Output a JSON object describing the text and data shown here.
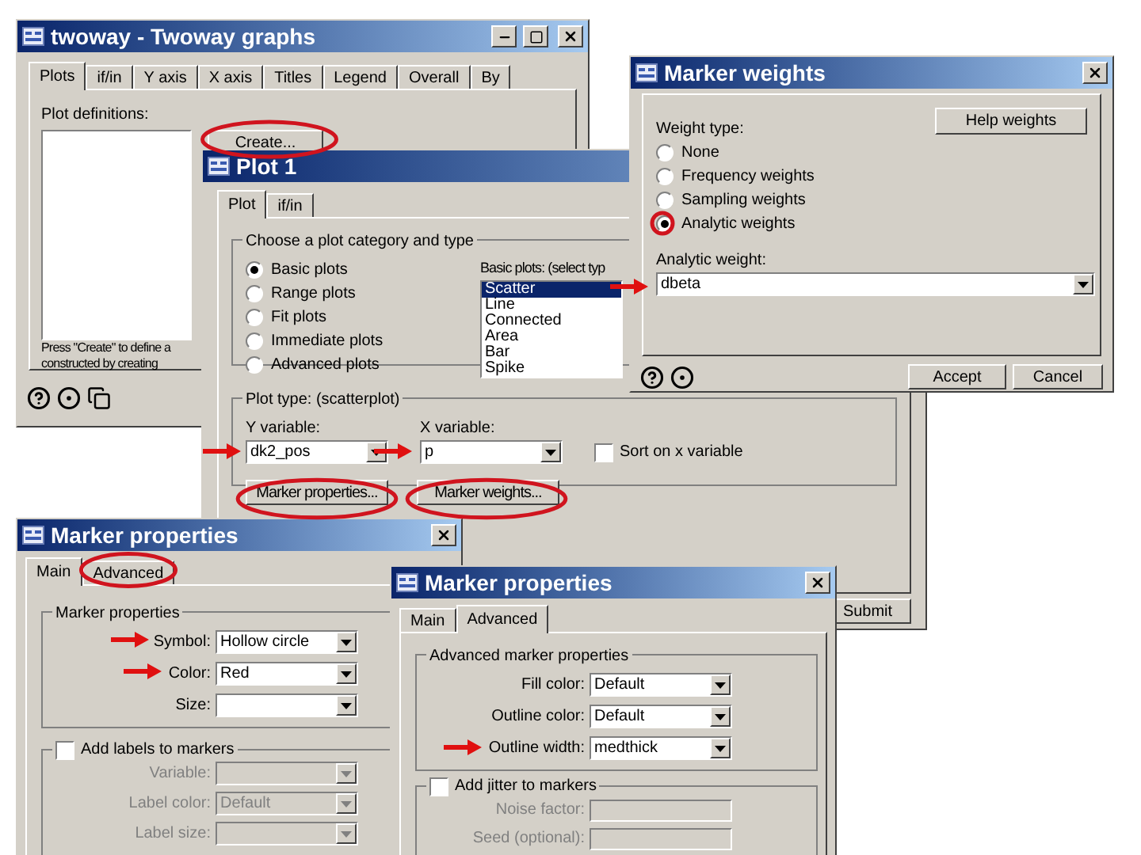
{
  "twoway_window": {
    "title": "twoway - Twoway graphs",
    "tabs": [
      {
        "label": "Plots",
        "selected": true
      },
      {
        "label": "if/in",
        "selected": false
      },
      {
        "label": "Y axis",
        "selected": false
      },
      {
        "label": "X axis",
        "selected": false
      },
      {
        "label": "Titles",
        "selected": false
      },
      {
        "label": "Legend",
        "selected": false
      },
      {
        "label": "Overall",
        "selected": false
      },
      {
        "label": "By",
        "selected": false
      }
    ],
    "list_label": "Plot definitions:",
    "create_button": "Create...",
    "hint_lines": [
      "Press \"Create\" to define a",
      "constructed by creating"
    ]
  },
  "plot1_window": {
    "title": "Plot 1",
    "tabs": [
      {
        "label": "Plot",
        "selected": true
      },
      {
        "label": "if/in",
        "selected": false
      }
    ],
    "category_group": {
      "title": "Choose a plot category and type",
      "options": [
        {
          "label": "Basic plots",
          "selected": true
        },
        {
          "label": "Range plots",
          "selected": false
        },
        {
          "label": "Fit plots",
          "selected": false
        },
        {
          "label": "Immediate plots",
          "selected": false
        },
        {
          "label": "Advanced plots",
          "selected": false
        }
      ],
      "type_list_label": "Basic plots: (select typ",
      "types": [
        {
          "label": "Scatter",
          "selected": true
        },
        {
          "label": "Line",
          "selected": false
        },
        {
          "label": "Connected",
          "selected": false
        },
        {
          "label": "Area",
          "selected": false
        },
        {
          "label": "Bar",
          "selected": false
        },
        {
          "label": "Spike",
          "selected": false
        }
      ]
    },
    "plot_type_group": {
      "title": "Plot type: (scatterplot)",
      "y_label": "Y variable:",
      "y_value": "dk2_pos",
      "x_label": "X variable:",
      "x_value": "p",
      "sort_checkbox": {
        "label": "Sort on x variable",
        "checked": false
      },
      "buttons": [
        "Marker properties...",
        "Marker weights..."
      ]
    },
    "submit_button": "Submit"
  },
  "marker_weights_window": {
    "title": "Marker weights",
    "weight_type_label": "Weight type:",
    "help_button": "Help weights",
    "options": [
      {
        "label": "None",
        "selected": false
      },
      {
        "label": "Frequency weights",
        "selected": false
      },
      {
        "label": "Sampling weights",
        "selected": false
      },
      {
        "label": "Analytic weights",
        "selected": true
      }
    ],
    "weight_label": "Analytic weight:",
    "weight_value": "dbeta",
    "buttons": [
      "Accept",
      "Cancel"
    ]
  },
  "marker_properties_main": {
    "title": "Marker properties",
    "tabs": [
      {
        "label": "Main",
        "selected": true
      },
      {
        "label": "Advanced",
        "selected": false
      }
    ],
    "group_title": "Marker properties",
    "fields": [
      {
        "label": "Symbol:",
        "value": "Hollow circle"
      },
      {
        "label": "Color:",
        "value": "Red"
      },
      {
        "label": "Size:"
      }
    ],
    "labels_checkbox": {
      "label": "Add labels to markers",
      "checked": false
    },
    "label_fields": [
      {
        "label": "Variable:"
      },
      {
        "label": "Label color:",
        "value": "Default"
      },
      {
        "label": "Label size:"
      }
    ]
  },
  "marker_properties_advanced": {
    "title": "Marker properties",
    "tabs": [
      {
        "label": "Main",
        "selected": false
      },
      {
        "label": "Advanced",
        "selected": true
      }
    ],
    "group_title": "Advanced marker properties",
    "fields": [
      {
        "label": "Fill color:",
        "value": "Default"
      },
      {
        "label": "Outline color:",
        "value": "Default"
      },
      {
        "label": "Outline width:",
        "value": "medthick"
      }
    ],
    "jitter_checkbox": {
      "label": "Add jitter to markers",
      "checked": false
    },
    "jitter_fields": [
      {
        "label": "Noise factor:"
      },
      {
        "label": "Seed (optional):"
      }
    ]
  }
}
